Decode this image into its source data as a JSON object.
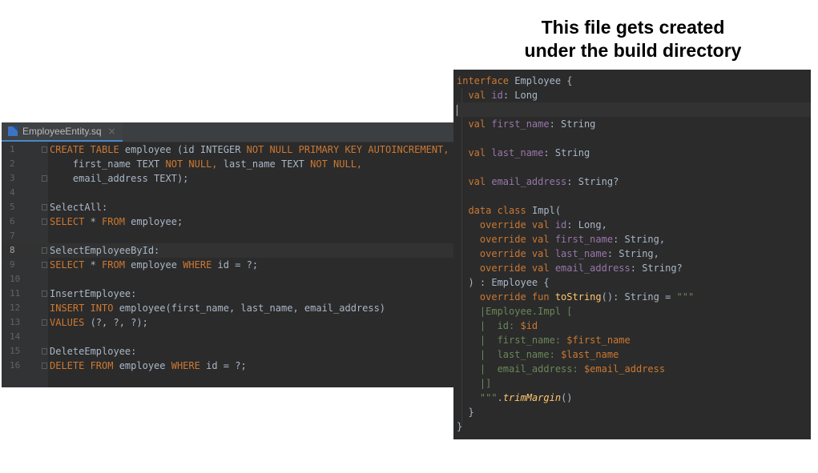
{
  "caption": {
    "line1": "This file gets created",
    "line2": "under the build directory"
  },
  "left_editor": {
    "tab_label": "EmployeeEntity.sq",
    "tab_close": "×",
    "current_line": 8,
    "lines": [
      {
        "n": "1",
        "parts": [
          {
            "t": "kw",
            "v": "CREATE TABLE "
          },
          {
            "t": "tx",
            "v": "employee (id INTEGER "
          },
          {
            "t": "kw",
            "v": "NOT NULL PRIMARY KEY AUTOINCREMENT,"
          }
        ]
      },
      {
        "n": "2",
        "parts": [
          {
            "t": "tx",
            "v": "    first_name TEXT "
          },
          {
            "t": "kw",
            "v": "NOT NULL, "
          },
          {
            "t": "tx",
            "v": "last_name TEXT "
          },
          {
            "t": "kw",
            "v": "NOT NULL,"
          }
        ]
      },
      {
        "n": "3",
        "parts": [
          {
            "t": "tx",
            "v": "    email_address TEXT);"
          }
        ]
      },
      {
        "n": "4",
        "parts": []
      },
      {
        "n": "5",
        "parts": [
          {
            "t": "tx",
            "v": "SelectAll:"
          }
        ]
      },
      {
        "n": "6",
        "parts": [
          {
            "t": "kw",
            "v": "SELECT "
          },
          {
            "t": "tx",
            "v": "* "
          },
          {
            "t": "kw",
            "v": "FROM "
          },
          {
            "t": "tx",
            "v": "employee;"
          }
        ]
      },
      {
        "n": "7",
        "parts": []
      },
      {
        "n": "8",
        "parts": [
          {
            "t": "tx",
            "v": "SelectEmployeeById:"
          }
        ]
      },
      {
        "n": "9",
        "parts": [
          {
            "t": "kw",
            "v": "SELECT "
          },
          {
            "t": "tx",
            "v": "* "
          },
          {
            "t": "kw",
            "v": "FROM "
          },
          {
            "t": "tx",
            "v": "employee "
          },
          {
            "t": "kw",
            "v": "WHERE "
          },
          {
            "t": "tx",
            "v": "id = ?;"
          }
        ]
      },
      {
        "n": "10",
        "parts": []
      },
      {
        "n": "11",
        "parts": [
          {
            "t": "tx",
            "v": "InsertEmployee:"
          }
        ]
      },
      {
        "n": "12",
        "parts": [
          {
            "t": "kw",
            "v": "INSERT INTO "
          },
          {
            "t": "tx",
            "v": "employee(first_name, last_name, email_address)"
          }
        ]
      },
      {
        "n": "13",
        "parts": [
          {
            "t": "kw",
            "v": "VALUES "
          },
          {
            "t": "tx",
            "v": "(?, ?, ?);"
          }
        ]
      },
      {
        "n": "14",
        "parts": []
      },
      {
        "n": "15",
        "parts": [
          {
            "t": "tx",
            "v": "DeleteEmployee:"
          }
        ]
      },
      {
        "n": "16",
        "parts": [
          {
            "t": "kw",
            "v": "DELETE FROM "
          },
          {
            "t": "tx",
            "v": "employee "
          },
          {
            "t": "kw",
            "v": "WHERE "
          },
          {
            "t": "tx",
            "v": "id = ?;"
          }
        ]
      }
    ]
  },
  "right_editor": {
    "lines": [
      [
        {
          "t": "kotlin-kw",
          "v": "interface "
        },
        {
          "t": "tx",
          "v": "Employee {"
        }
      ],
      [
        {
          "t": "tx",
          "v": "  "
        },
        {
          "t": "kotlin-kw",
          "v": "val "
        },
        {
          "t": "prop",
          "v": "id"
        },
        {
          "t": "tx",
          "v": ": Long"
        }
      ],
      [],
      [
        {
          "t": "tx",
          "v": "  "
        },
        {
          "t": "kotlin-kw",
          "v": "val "
        },
        {
          "t": "prop",
          "v": "first_name"
        },
        {
          "t": "tx",
          "v": ": String"
        }
      ],
      [],
      [
        {
          "t": "tx",
          "v": "  "
        },
        {
          "t": "kotlin-kw",
          "v": "val "
        },
        {
          "t": "prop",
          "v": "last_name"
        },
        {
          "t": "tx",
          "v": ": String"
        }
      ],
      [],
      [
        {
          "t": "tx",
          "v": "  "
        },
        {
          "t": "kotlin-kw",
          "v": "val "
        },
        {
          "t": "prop",
          "v": "email_address"
        },
        {
          "t": "tx",
          "v": ": String?"
        }
      ],
      [],
      [
        {
          "t": "tx",
          "v": "  "
        },
        {
          "t": "kotlin-kw",
          "v": "data class "
        },
        {
          "t": "tx",
          "v": "Impl("
        }
      ],
      [
        {
          "t": "tx",
          "v": "    "
        },
        {
          "t": "kotlin-kw",
          "v": "override val "
        },
        {
          "t": "prop",
          "v": "id"
        },
        {
          "t": "tx",
          "v": ": Long,"
        }
      ],
      [
        {
          "t": "tx",
          "v": "    "
        },
        {
          "t": "kotlin-kw",
          "v": "override val "
        },
        {
          "t": "prop",
          "v": "first_name"
        },
        {
          "t": "tx",
          "v": ": String,"
        }
      ],
      [
        {
          "t": "tx",
          "v": "    "
        },
        {
          "t": "kotlin-kw",
          "v": "override val "
        },
        {
          "t": "prop",
          "v": "last_name"
        },
        {
          "t": "tx",
          "v": ": String,"
        }
      ],
      [
        {
          "t": "tx",
          "v": "    "
        },
        {
          "t": "kotlin-kw",
          "v": "override val "
        },
        {
          "t": "prop",
          "v": "email_address"
        },
        {
          "t": "tx",
          "v": ": String?"
        }
      ],
      [
        {
          "t": "tx",
          "v": "  ) : Employee {"
        }
      ],
      [
        {
          "t": "tx",
          "v": "    "
        },
        {
          "t": "kotlin-kw",
          "v": "override fun "
        },
        {
          "t": "fn",
          "v": "toString"
        },
        {
          "t": "tx",
          "v": "(): String = "
        },
        {
          "t": "str",
          "v": "\"\"\""
        }
      ],
      [
        {
          "t": "tx",
          "v": "    "
        },
        {
          "t": "str",
          "v": "|Employee.Impl ["
        }
      ],
      [
        {
          "t": "tx",
          "v": "    "
        },
        {
          "t": "str",
          "v": "|  id: "
        },
        {
          "t": "tmpl",
          "v": "$id"
        }
      ],
      [
        {
          "t": "tx",
          "v": "    "
        },
        {
          "t": "str",
          "v": "|  first_name: "
        },
        {
          "t": "tmpl",
          "v": "$first_name"
        }
      ],
      [
        {
          "t": "tx",
          "v": "    "
        },
        {
          "t": "str",
          "v": "|  last_name: "
        },
        {
          "t": "tmpl",
          "v": "$last_name"
        }
      ],
      [
        {
          "t": "tx",
          "v": "    "
        },
        {
          "t": "str",
          "v": "|  email_address: "
        },
        {
          "t": "tmpl",
          "v": "$email_address"
        }
      ],
      [
        {
          "t": "tx",
          "v": "    "
        },
        {
          "t": "str",
          "v": "|]"
        }
      ],
      [
        {
          "t": "tx",
          "v": "    "
        },
        {
          "t": "str",
          "v": "\"\"\""
        },
        {
          "t": "tx",
          "v": "."
        },
        {
          "t": "fn-i",
          "v": "trimMargin"
        },
        {
          "t": "tx",
          "v": "()"
        }
      ],
      [
        {
          "t": "tx",
          "v": "  }"
        }
      ],
      [
        {
          "t": "tx",
          "v": "}"
        }
      ]
    ],
    "caret_line_index": 2
  },
  "colors": {
    "keyword": "#cc7832",
    "text": "#a9b7c6",
    "property": "#9876aa",
    "function": "#ffc66d",
    "string": "#6a8759",
    "background": "#2b2b2b"
  }
}
